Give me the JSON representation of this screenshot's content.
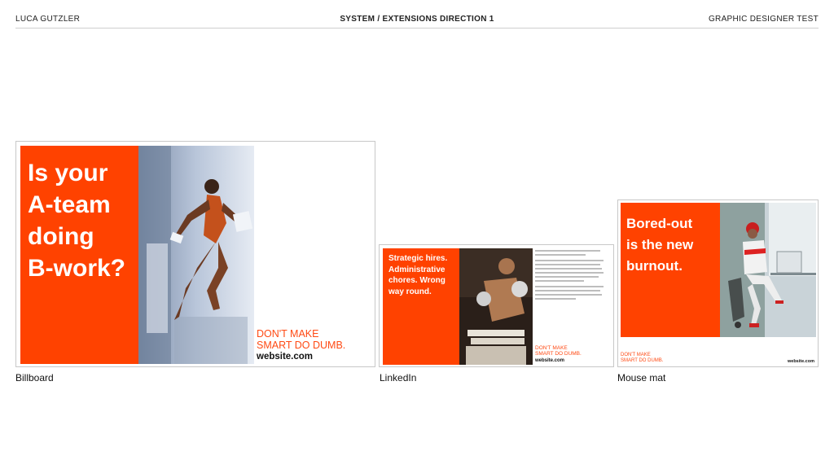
{
  "header": {
    "left": "LUCA GUTZLER",
    "center": "SYSTEM / EXTENSIONS DIRECTION 1",
    "right": "GRAPHIC DESIGNER TEST"
  },
  "billboard": {
    "headline_lines": [
      "Is your",
      "A-team",
      "doing",
      "B-work?"
    ],
    "tagline_lines": [
      "DON'T MAKE",
      "SMART DO DUMB."
    ],
    "website": "website.com",
    "caption": "Billboard"
  },
  "linkedin": {
    "headline_lines": [
      "Strategic hires.",
      "Administrative",
      "chores. Wrong",
      "way round."
    ],
    "tagline_lines": [
      "DON'T MAKE",
      "SMART DO DUMB."
    ],
    "website": "website.com",
    "caption": "LinkedIn"
  },
  "mousemat": {
    "headline_lines": [
      "Bored-out",
      "is the new",
      "burnout."
    ],
    "tagline_lines": [
      "DON'T MAKE",
      "SMART DO DUMB."
    ],
    "website": "website.com",
    "caption": "Mouse mat"
  },
  "colors": {
    "brand_orange": "#ff4200",
    "tagline_orange": "#ff4a14"
  }
}
